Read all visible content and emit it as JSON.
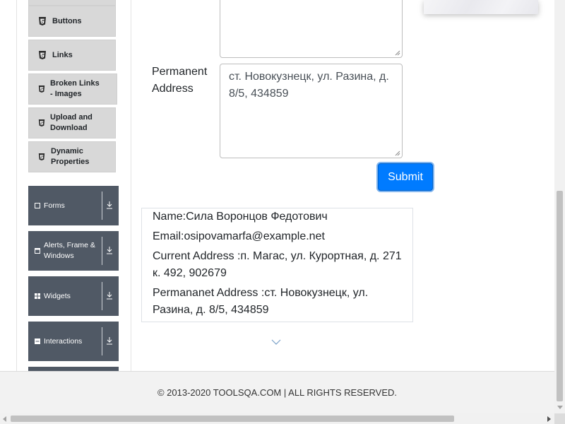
{
  "sidebar": {
    "sub_items": [
      {
        "label": "Buttons",
        "icon": "html5-icon"
      },
      {
        "label": "Links",
        "icon": "html5-icon"
      },
      {
        "label": "Broken Links - Images",
        "icon": "html5-icon"
      },
      {
        "label": "Upload and Download",
        "icon": "html5-icon"
      },
      {
        "label": "Dynamic Properties",
        "icon": "html5-icon"
      }
    ],
    "groups": [
      {
        "label": "Forms",
        "icon": "form-icon"
      },
      {
        "label": "Alerts, Frame & Windows",
        "icon": "window-icon"
      },
      {
        "label": "Widgets",
        "icon": "grid-icon"
      },
      {
        "label": "Interactions",
        "icon": "list-icon"
      }
    ]
  },
  "form": {
    "permanent_address_label": "Permanent Address",
    "permanent_address_value": "ст. Новокузнецк, ул. Разина, д. 8/5, 434859",
    "current_address_value": "",
    "submit_label": "Submit"
  },
  "output": {
    "name": "Name:Сила Воронцов Федотович",
    "email": "Email:osipovamarfa@example.net",
    "current_address": "Current Address :п. Магас, ул. Курортная, д. 271 к. 492, 902679",
    "permanent_address": "Permananet Address :ст. Новокузнецк, ул. Разина, д. 8/5, 434859"
  },
  "footer": {
    "copyright": "© 2013-2020 TOOLSQA.COM | ALL RIGHTS RESERVED."
  },
  "colors": {
    "accent": "#007bff",
    "group_header": "#505965",
    "sub_item_bg": "#d8d8d8"
  }
}
